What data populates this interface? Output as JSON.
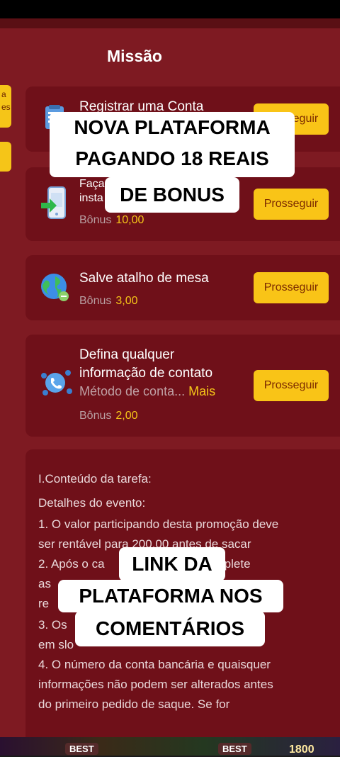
{
  "header": {
    "title": "Missão"
  },
  "side_tabs": [
    "a\nes",
    ""
  ],
  "tasks": [
    {
      "title": "Registrar uma Conta",
      "bonus_label": "",
      "bonus_value": "",
      "button": "Prosseguir"
    },
    {
      "title": "Faça\ninsta",
      "bonus_label": "Bônus",
      "bonus_value": "10,00",
      "button": "Prosseguir"
    },
    {
      "title": "Salve atalho de mesa",
      "bonus_label": "Bônus",
      "bonus_value": "3,00",
      "button": "Prosseguir"
    },
    {
      "title": "Defina qualquer\ninformação de contato",
      "sub": "Método de conta...",
      "more": "Mais",
      "bonus_label": "Bônus",
      "bonus_value": "2,00",
      "button": "Prosseguir"
    }
  ],
  "details": {
    "heading": "I.Conteúdo da tarefa:",
    "lines": [
      "Detalhes do evento:",
      "1. O valor participando desta promoção deve",
      "ser rentável para 200,00 antes de sacar",
      "2. Após o ca                    nbro,Complete",
      "as",
      "re",
      "3. Os                                        apostas",
      "em slo",
      "4. O número da conta bancária e quaisquer",
      "informações não podem ser alterados antes",
      "do primeiro pedido de saque. Se for"
    ]
  },
  "overlays": {
    "top": [
      "NOVA PLATAFORMA",
      "PAGANDO 18 REAIS",
      "DE BONUS"
    ],
    "bottom": [
      "LINK DA",
      "PLATAFORMA NOS",
      "COMENTÁRIOS"
    ]
  },
  "bottom_bar": {
    "labels": [
      "BEST",
      "BEST",
      "1800"
    ]
  }
}
